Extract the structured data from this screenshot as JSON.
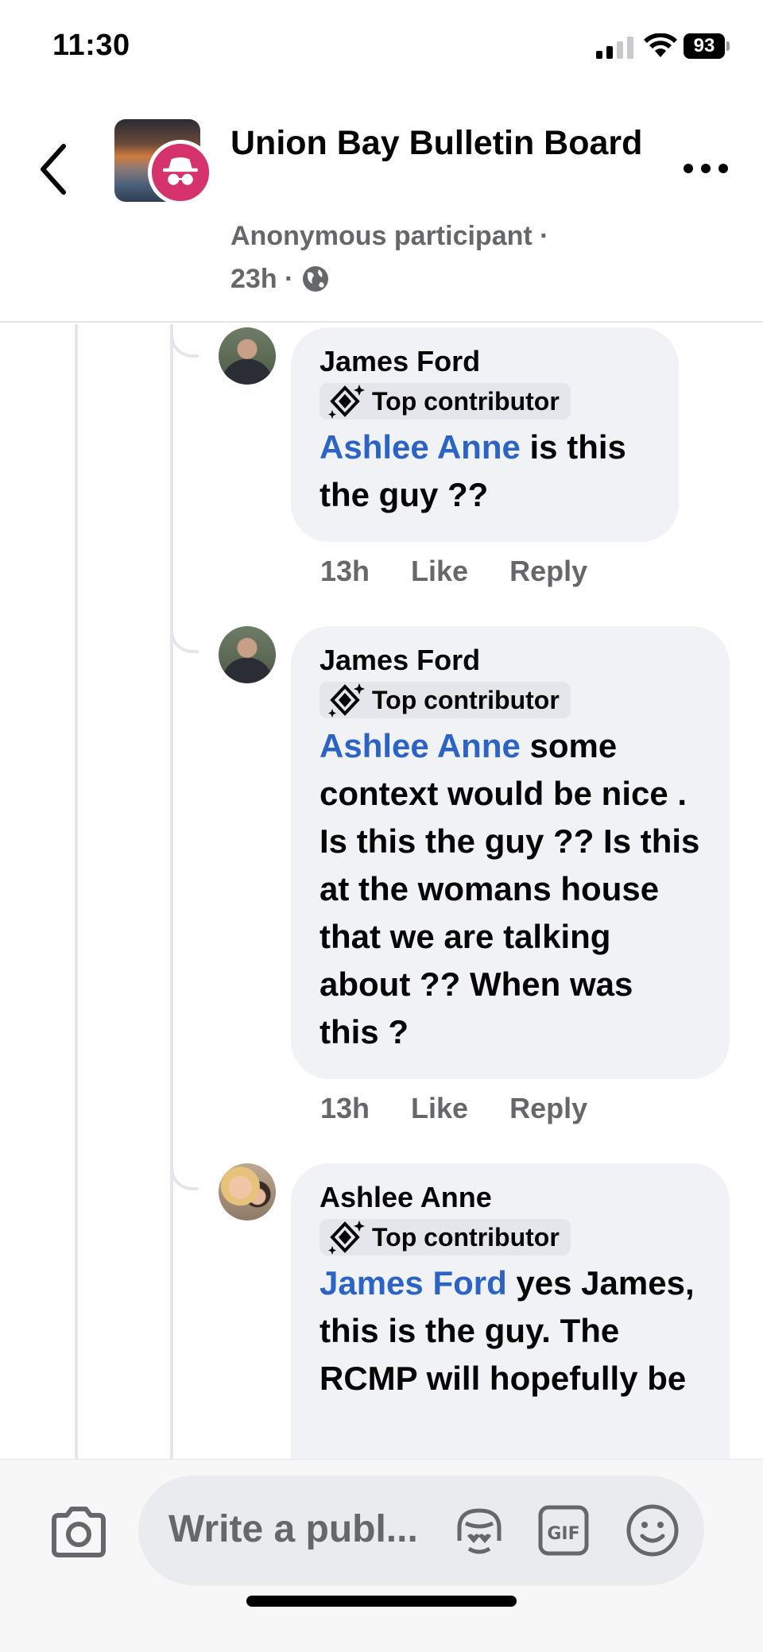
{
  "status_bar": {
    "time": "11:30",
    "battery": "93"
  },
  "header": {
    "back_icon": "chevron-left-icon",
    "group_name": "Union Bay Bulletin Board",
    "author": "Anonymous participant",
    "separator": "·",
    "time": "23h",
    "more_icon": "more-horizontal-icon",
    "anonymous_badge_color": "#d6336c"
  },
  "comments": [
    {
      "author": "James Ford",
      "badge": "Top contributor",
      "mention": "Ashlee Anne",
      "text": " is this the guy ??",
      "time": "13h",
      "like": "Like",
      "reply": "Reply"
    },
    {
      "author": "James Ford",
      "badge": "Top contributor",
      "mention": "Ashlee Anne",
      "text": " some context would be nice . Is this the guy ?? Is this at the womans house that we are talking about ?? When was this ?",
      "time": "13h",
      "like": "Like",
      "reply": "Reply"
    },
    {
      "author": "Ashlee Anne",
      "badge": "Top contributor",
      "mention": "James Ford",
      "text": " yes James, this is the guy. The RCMP will hopefully be"
    }
  ],
  "composer": {
    "placeholder": "Write a publ...",
    "camera_icon": "camera-icon",
    "avatar_sticker_icon": "avatar-sticker-icon",
    "gif_label": "GIF",
    "emoji_icon": "smiley-icon"
  },
  "colors": {
    "mention": "#2b64c4",
    "bubble": "#f0f2f5",
    "secondary_text": "#65676b"
  }
}
